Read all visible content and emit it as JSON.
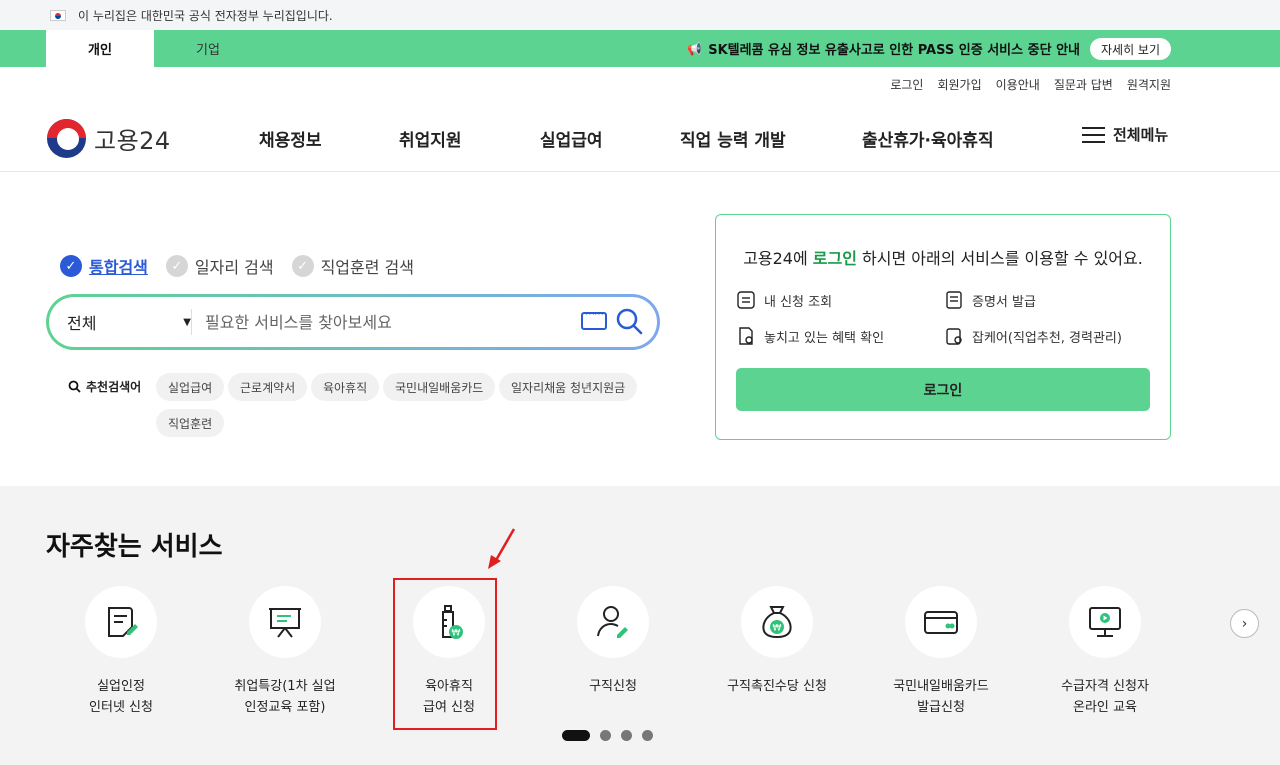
{
  "gov_banner": {
    "text": "이 누리집은 대한민국 공식 전자정부 누리집입니다."
  },
  "top_tabs": [
    {
      "label": "개인"
    },
    {
      "label": "기업"
    }
  ],
  "notice": {
    "text": "SK텔레콤 유심 정보 유출사고로 인한 PASS 인증 서비스 중단 안내",
    "button": "자세히 보기"
  },
  "util_links": [
    "로그인",
    "회원가입",
    "이용안내",
    "질문과 답변",
    "원격지원"
  ],
  "logo": {
    "text": "고용24"
  },
  "gnb": [
    "채용정보",
    "취업지원",
    "실업급여",
    "직업 능력 개발",
    "출산휴가·육아휴직"
  ],
  "all_menu": "전체메뉴",
  "search_tabs": [
    "통합검색",
    "일자리 검색",
    "직업훈련 검색"
  ],
  "search": {
    "select": "전체",
    "placeholder": "필요한 서비스를 찾아보세요"
  },
  "recommend": {
    "label": "추천검색어",
    "chips": [
      "실업급여",
      "근로계약서",
      "육아휴직",
      "국민내일배움카드",
      "일자리채움 청년지원금",
      "직업훈련"
    ]
  },
  "login_card": {
    "title_pre": "고용24에 ",
    "title_link": "로그인",
    "title_post": " 하시면 아래의 서비스를 이용할 수 있어요.",
    "items": [
      "내 신청 조회",
      "증명서 발급",
      "놓치고 있는 혜택 확인",
      "잡케어(직업추천, 경력관리)"
    ],
    "button": "로그인"
  },
  "services": {
    "title": "자주찾는 서비스",
    "items": [
      {
        "label": "실업인정\n인터넷 신청",
        "icon": "document-edit-icon"
      },
      {
        "label": "취업특강(1차 실업\n인정교육 포함)",
        "icon": "presentation-board-icon"
      },
      {
        "label": "육아휴직\n급여 신청",
        "icon": "baby-bottle-won-icon"
      },
      {
        "label": "구직신청",
        "icon": "person-edit-icon"
      },
      {
        "label": "구직촉진수당 신청",
        "icon": "money-bag-won-icon"
      },
      {
        "label": "국민내일배움카드\n발급신청",
        "icon": "card-icon"
      },
      {
        "label": "수급자격 신청자\n온라인 교육",
        "icon": "monitor-play-icon"
      }
    ]
  },
  "colors": {
    "brand_green": "#5dd391",
    "accent_blue": "#2b5ad8",
    "highlight_red": "#e02020"
  }
}
